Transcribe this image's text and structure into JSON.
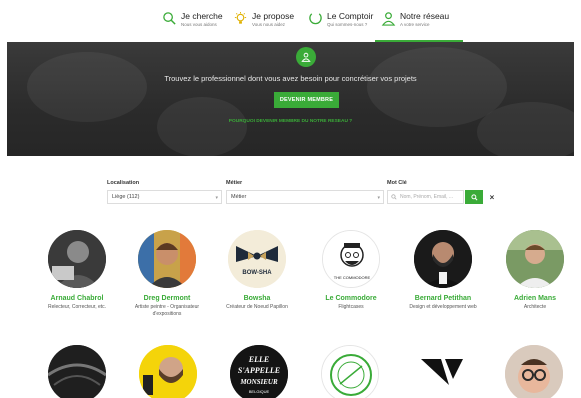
{
  "nav": {
    "items": [
      {
        "title": "Je cherche",
        "subtitle": "Nous vous aidons",
        "icon": "search-icon"
      },
      {
        "title": "Je propose",
        "subtitle": "Vous nous aidez",
        "icon": "lightbulb-icon"
      },
      {
        "title": "Le Comptoir",
        "subtitle": "Qui sommes-nous ?",
        "icon": "circle-icon"
      },
      {
        "title": "Notre réseau",
        "subtitle": "A votre service",
        "icon": "user-icon"
      }
    ],
    "active_index": 3
  },
  "hero": {
    "tagline": "Trouvez le professionnel dont vous avez besoin pour concrétiser vos projets",
    "cta_label": "DEVENIR MEMBRE",
    "why_label": "POURQUOI DEVENIR MEMBRE DU NOTRE RESEAU ?"
  },
  "search": {
    "location_label": "Localisation",
    "location_value": "Liège (112)",
    "job_label": "Métier",
    "job_value": "Métier",
    "keyword_label": "Mot Clé",
    "keyword_placeholder": "Nom, Prénom, Email, ..."
  },
  "members": [
    {
      "name": "Arnaud Chabrol",
      "job": "Relecteur, Correcteur, etc."
    },
    {
      "name": "Dreg Dermont",
      "job": "Artiste peintre - Organisateur d'expositions"
    },
    {
      "name": "Bowsha",
      "job": "Créateur de Noeud Papillon"
    },
    {
      "name": "Le Commodore",
      "job": "Flightcases"
    },
    {
      "name": "Bernard Petithan",
      "job": "Design et développement web"
    },
    {
      "name": "Adrien Mans",
      "job": "Architecte"
    }
  ],
  "logos": {
    "bowsha_text": "BOW-SHA",
    "commodore_text": "THE COMMODORE",
    "elle_text": "ELLE S'APPELLE MONSIEUR",
    "elle_sub": "BELGIQUE"
  },
  "colors": {
    "accent": "#3aab38",
    "hero_bg": "#2e2e2e"
  }
}
